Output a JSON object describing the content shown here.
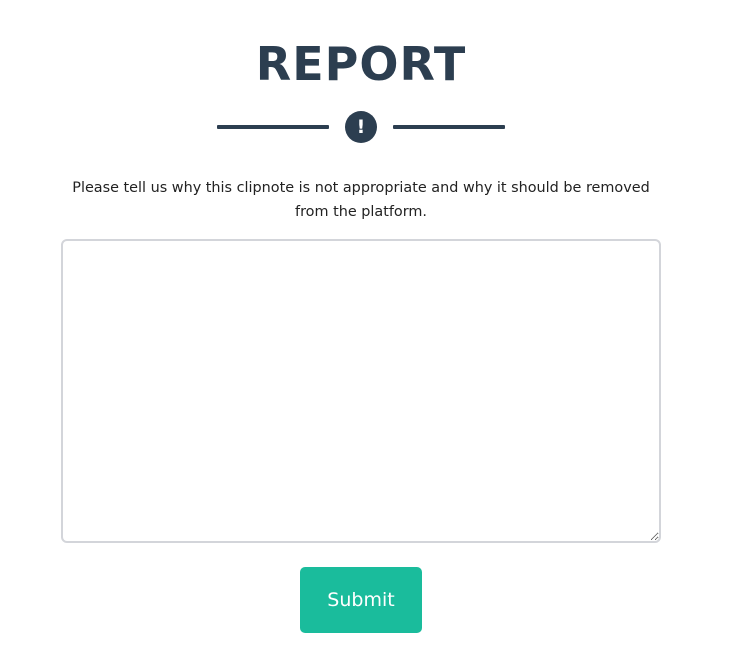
{
  "report": {
    "title": "REPORT",
    "alert_icon": "exclamation-icon",
    "alert_glyph": "!",
    "prompt": "Please tell us why this clipnote is not appropriate and why it should be removed from the platform.",
    "reason_value": "",
    "submit_label": "Submit"
  },
  "colors": {
    "heading": "#2c3e50",
    "accent": "#1abc9c",
    "input_border": "#d3d5da"
  }
}
